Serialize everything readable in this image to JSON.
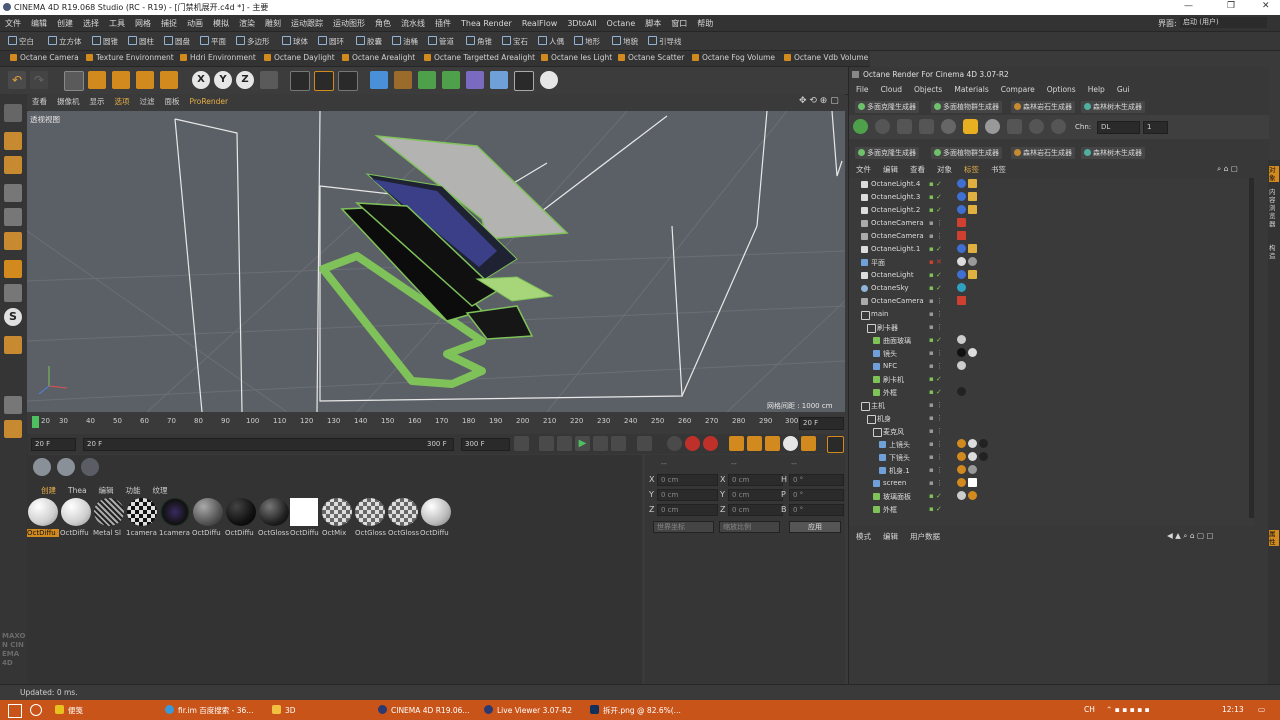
{
  "window": {
    "title": "CINEMA 4D R19.068 Studio (RC - R19) - [门禁机展开.c4d *] - 主要",
    "layout_label": "界面:",
    "layout_value": "启动 (用户)"
  },
  "menubar": [
    "文件",
    "编辑",
    "创建",
    "选择",
    "工具",
    "网格",
    "捕捉",
    "动画",
    "模拟",
    "渲染",
    "雕刻",
    "运动跟踪",
    "运动图形",
    "角色",
    "流水线",
    "插件",
    "Thea Render",
    "RealFlow",
    "3DtoAll",
    "Octane",
    "脚本",
    "窗口",
    "帮助"
  ],
  "toolbar1": [
    "空白",
    "立方体",
    "圆锥",
    "圆柱",
    "圆盘",
    "平面",
    "多边形",
    "球体",
    "圆环",
    "胶囊",
    "油桶",
    "管道",
    "角锥",
    "宝石",
    "人偶",
    "地形",
    "地貌",
    "引导线"
  ],
  "toolbar2": [
    "Octane Camera",
    "Texture Environment",
    "Hdri Environment",
    "Octane Daylight",
    "Octane Arealight",
    "Octane Targetted Arealight",
    "Octane Ies Light",
    "Octane Scatter",
    "Octane Fog Volume",
    "Octane Vdb Volume"
  ],
  "viewport": {
    "menu": [
      "查看",
      "摄像机",
      "显示",
      "选项",
      "过滤",
      "面板",
      "ProRender"
    ],
    "label": "透视视图",
    "grid_text": "网格间距 : 1000 cm"
  },
  "timeline": {
    "ticks": [
      "20",
      "30",
      "40",
      "50",
      "60",
      "70",
      "80",
      "90",
      "100",
      "110",
      "120",
      "130",
      "140",
      "150",
      "160",
      "170",
      "180",
      "190",
      "200",
      "210",
      "220",
      "230",
      "240",
      "250",
      "260",
      "270",
      "280",
      "290",
      "300"
    ],
    "current_frame": "20 F",
    "start_field": "20 F",
    "range_start": "20 F",
    "range_end": "300 F",
    "end_field": "300 F"
  },
  "material_manager": {
    "menu": [
      "创建",
      "Thea",
      "编辑",
      "功能",
      "纹理"
    ],
    "materials": [
      "OctDiffu",
      "OctDiffu",
      "Metal Sl",
      "1camera",
      "1camera",
      "OctDiffu",
      "OctDiffu",
      "OctGloss",
      "OctDiffu",
      "OctMix",
      "OctGloss",
      "OctGloss",
      "OctDiffu"
    ]
  },
  "coordinates": {
    "header": [
      "--",
      "--",
      "--"
    ],
    "rows": [
      {
        "axis": "X",
        "pos": "0 cm",
        "size": "0 cm",
        "rot_label": "H",
        "rot": "0 °"
      },
      {
        "axis": "Y",
        "pos": "0 cm",
        "size": "0 cm",
        "rot_label": "P",
        "rot": "0 °"
      },
      {
        "axis": "Z",
        "pos": "0 cm",
        "size": "0 cm",
        "rot_label": "B",
        "rot": "0 °"
      }
    ],
    "mode1": "世界坐标",
    "mode2": "缩放比例",
    "apply": "应用"
  },
  "octane": {
    "title": "Octane Render For Cinema 4D 3.07-R2",
    "menu": [
      "File",
      "Cloud",
      "Objects",
      "Materials",
      "Compare",
      "Options",
      "Help",
      "Gui"
    ],
    "generators": [
      "多面克隆生成器",
      "多面植物群生成器",
      "森林岩石生成器",
      "森林树木生成器"
    ],
    "chn_label": "Chn:",
    "chn_value": "DL",
    "chn_num": "1"
  },
  "object_manager": {
    "menu": [
      "文件",
      "编辑",
      "查看",
      "对象",
      "标签",
      "书签"
    ],
    "objects": [
      {
        "name": "OctaneLight.4",
        "indent": 0,
        "color": "#dddddd"
      },
      {
        "name": "OctaneLight.3",
        "indent": 0,
        "color": "#dddddd"
      },
      {
        "name": "OctaneLight.2",
        "indent": 0,
        "color": "#dddddd"
      },
      {
        "name": "OctaneCamera",
        "indent": 0,
        "color": "#aaaaaa"
      },
      {
        "name": "OctaneCamera",
        "indent": 0,
        "color": "#aaaaaa"
      },
      {
        "name": "OctaneLight.1",
        "indent": 0,
        "color": "#dddddd"
      },
      {
        "name": "平面",
        "indent": 0,
        "color": "#6fa0d8"
      },
      {
        "name": "OctaneLight",
        "indent": 0,
        "color": "#dddddd"
      },
      {
        "name": "OctaneSky",
        "indent": 0,
        "color": "#8fb3d9"
      },
      {
        "name": "OctaneCamera",
        "indent": 0,
        "color": "#aaaaaa"
      },
      {
        "name": "main",
        "indent": 0,
        "color": "#cfcfcf"
      },
      {
        "name": "刷卡器",
        "indent": 1,
        "color": "#cfcfcf"
      },
      {
        "name": "曲面玻璃",
        "indent": 2,
        "color": "#7fc25a"
      },
      {
        "name": "镜头",
        "indent": 2,
        "color": "#6fa0d8"
      },
      {
        "name": "NFC",
        "indent": 2,
        "color": "#6fa0d8"
      },
      {
        "name": "刷卡机",
        "indent": 2,
        "color": "#7fc25a"
      },
      {
        "name": "外框",
        "indent": 2,
        "color": "#7fc25a"
      },
      {
        "name": "主机",
        "indent": 0,
        "color": "#cfcfcf"
      },
      {
        "name": "机身",
        "indent": 1,
        "color": "#cfcfcf"
      },
      {
        "name": "麦克风",
        "indent": 2,
        "color": "#cfcfcf"
      },
      {
        "name": "上镜头",
        "indent": 3,
        "color": "#6fa0d8"
      },
      {
        "name": "下镜头",
        "indent": 3,
        "color": "#6fa0d8"
      },
      {
        "name": "机身.1",
        "indent": 3,
        "color": "#6fa0d8"
      },
      {
        "name": "screen",
        "indent": 2,
        "color": "#6fa0d8"
      },
      {
        "name": "玻璃面板",
        "indent": 2,
        "color": "#7fc25a"
      },
      {
        "name": "外框",
        "indent": 2,
        "color": "#7fc25a"
      }
    ]
  },
  "attributes_menu": [
    "模式",
    "编辑",
    "用户数据"
  ],
  "side_tabs": [
    "对象",
    "内容浏览器",
    "构造",
    "属性"
  ],
  "brand": "MAXON CINEMA 4D",
  "status": "Updated: 0 ms.",
  "taskbar": {
    "items": [
      "便笺",
      "fir.im 百度搜索 - 36...",
      "3D",
      "CINEMA 4D R19.06...",
      "Live Viewer 3.07-R2",
      "拆开.png @ 82.6%(..."
    ],
    "ime": "CH",
    "time": "12:13"
  },
  "colors": {
    "accent_orange": "#d28a1e",
    "taskbar": "#c9541a",
    "wire_green": "#7fc25a",
    "viewport_bg": "#5b6066"
  }
}
